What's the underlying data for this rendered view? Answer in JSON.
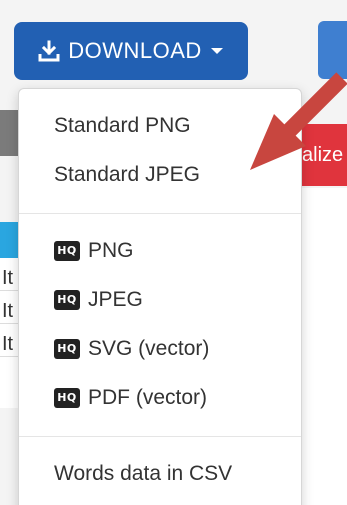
{
  "background": {
    "banner_text": "alize",
    "left_rows": [
      "It",
      "It",
      "It"
    ]
  },
  "download_button": {
    "label": "DOWNLOAD",
    "icon": "download-icon",
    "caret_icon": "caret-down-icon"
  },
  "menu": {
    "standard_items": [
      {
        "label": "Standard PNG"
      },
      {
        "label": "Standard JPEG"
      }
    ],
    "hq_items": [
      {
        "badge": "HQ",
        "label": "PNG"
      },
      {
        "badge": "HQ",
        "label": "JPEG"
      },
      {
        "badge": "HQ",
        "label": "SVG (vector)"
      },
      {
        "badge": "HQ",
        "label": "PDF (vector)"
      }
    ],
    "data_items": [
      {
        "label": "Words data in CSV"
      }
    ]
  },
  "colors": {
    "button": "#2260b3",
    "arrow": "#c8463f",
    "banner": "#e0343d"
  }
}
